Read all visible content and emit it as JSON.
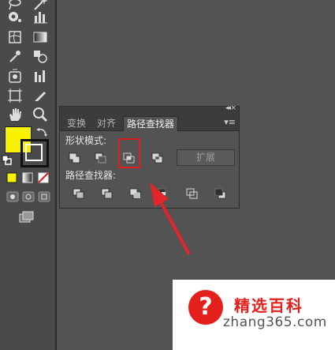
{
  "panel": {
    "tabs": [
      "变换",
      "对齐",
      "路径查找器"
    ],
    "active_tab": "路径查找器",
    "shape_modes_label": "形状模式:",
    "pathfinders_label": "路径查找器:",
    "expand_label": "扩展",
    "collapse_glyph": "◂◂",
    "close_glyph": "×",
    "menu_glyph": "▾≡"
  },
  "swatches": {
    "fill": "#f7f200",
    "stroke": "#111111"
  },
  "colors": {
    "highlight": "#e01e1e",
    "arrow": "#e2252b",
    "panel_bg": "#535353",
    "toolbar_bg": "#4a4a4a"
  },
  "watermark": {
    "logo_glyph": "?",
    "title": "精选百科",
    "url": "zhang365.com"
  }
}
